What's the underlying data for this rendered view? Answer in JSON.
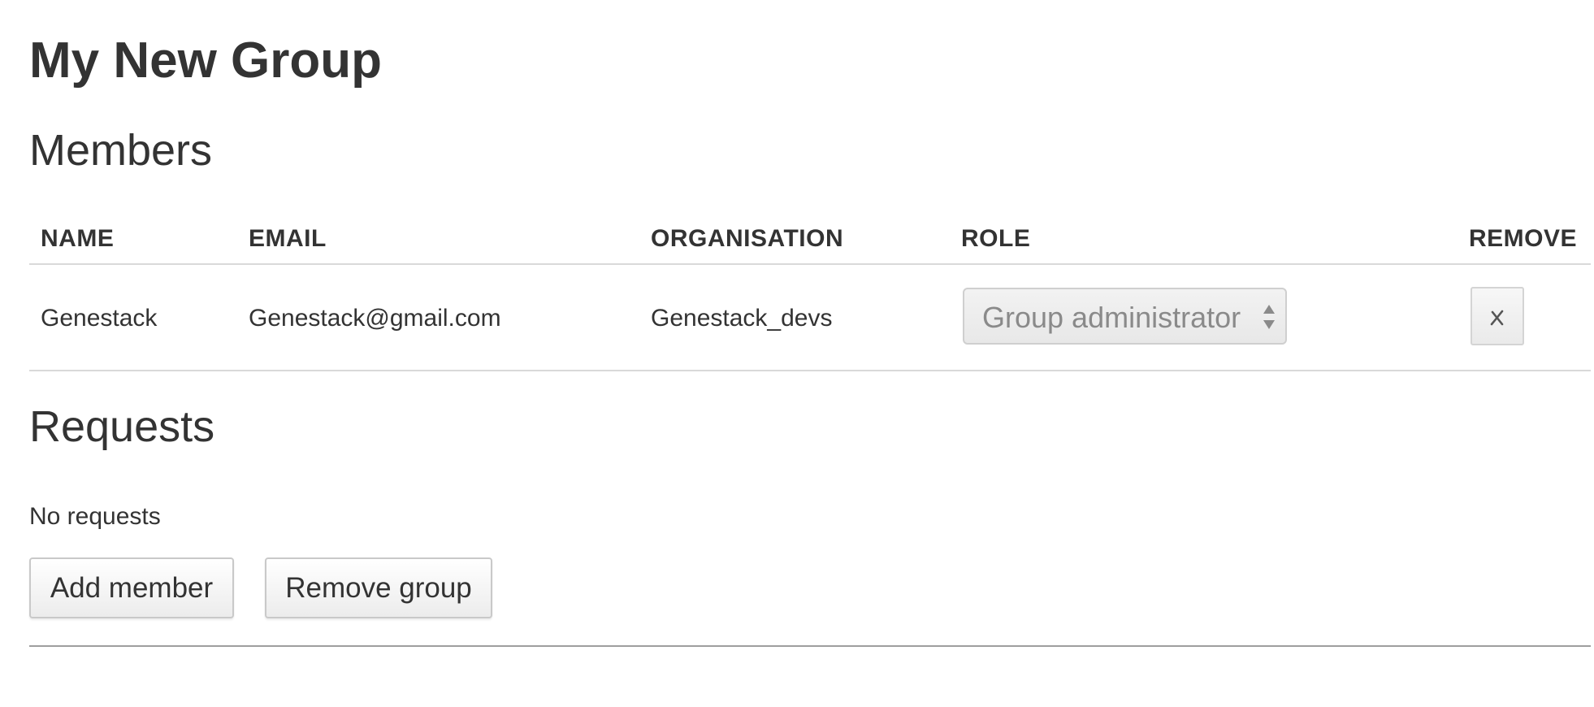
{
  "page": {
    "title": "My New Group"
  },
  "members": {
    "heading": "Members",
    "columns": {
      "name": "NAME",
      "email": "EMAIL",
      "organisation": "ORGANISATION",
      "role": "ROLE",
      "remove": "REMOVE"
    },
    "rows": [
      {
        "name": "Genestack",
        "email": "Genestack@gmail.com",
        "organisation": "Genestack_devs",
        "role": "Group administrator",
        "remove_icon": "close-x-icon"
      }
    ]
  },
  "requests": {
    "heading": "Requests",
    "empty_text": "No requests"
  },
  "actions": {
    "add_member_label": "Add member",
    "remove_group_label": "Remove group"
  },
  "colors": {
    "text": "#333333",
    "muted_text": "#8a8a8a",
    "divider": "#d9d9d9",
    "bottom_rule": "#9e9e9e"
  }
}
